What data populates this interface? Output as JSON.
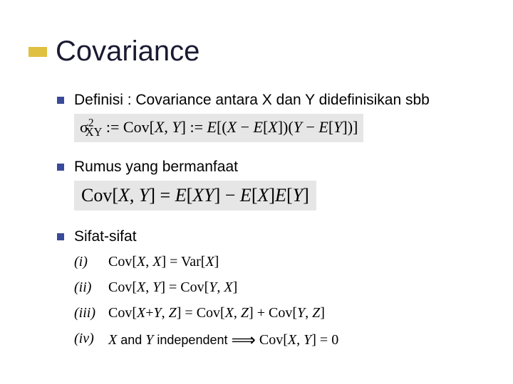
{
  "title": "Covariance",
  "bullets": [
    {
      "text": "Definisi : Covariance antara X dan Y didefinisikan sbb",
      "formula_html": "&sigma;<sup>2</sup><sub style='margin-left:-12px'>XY</sub> := Cov[<i>X</i>, <i>Y</i>] := <i>E</i>[(<i>X</i> &minus; <i>E</i>[<i>X</i>])(<i>Y</i> &minus; <i>E</i>[<i>Y</i>])]"
    },
    {
      "text": "Rumus yang bermanfaat",
      "formula_html": "Cov[<i>X</i>, <i>Y</i>] = <i>E</i>[<i>XY</i>] &minus; <i>E</i>[<i>X</i>]<i>E</i>[<i>Y</i>]"
    },
    {
      "text": "Sifat-sifat",
      "properties": [
        {
          "num": "(i)",
          "html": "Cov[<i>X</i>, <i>X</i>] = Var[<i>X</i>]"
        },
        {
          "num": "(ii)",
          "html": "Cov[<i>X</i>, <i>Y</i>] = Cov[<i>Y</i>, <i>X</i>]"
        },
        {
          "num": "(iii)",
          "html": "Cov[<i>X</i>+<i>Y</i>, <i>Z</i>] = Cov[<i>X</i>, <i>Z</i>] + Cov[<i>Y</i>, <i>Z</i>]"
        },
        {
          "num": "(iv)",
          "html": "<i>X</i> <span style='font-family:Verdana,sans-serif;font-size:18px'>and</span> <i>Y</i> <span style='font-family:Verdana,sans-serif;font-size:18px'>independent</span> <span class='implies'>&#x27F9;</span> Cov[<i>X</i>, <i>Y</i>] = 0"
        }
      ]
    }
  ]
}
